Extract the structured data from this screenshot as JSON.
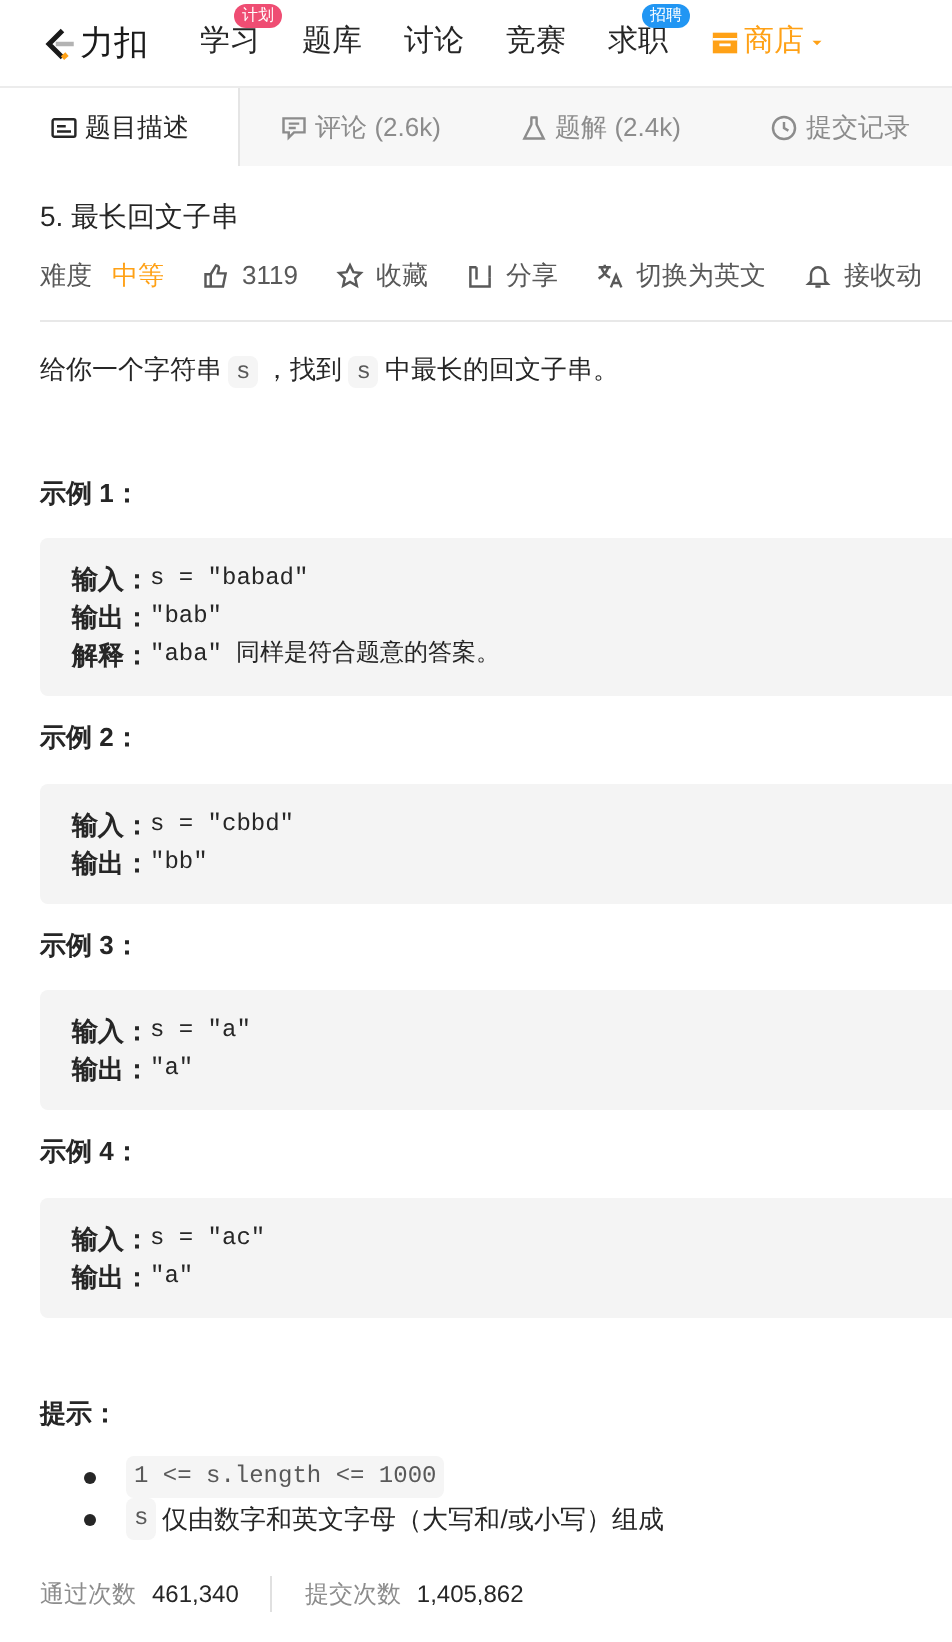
{
  "nav": {
    "logo_text": "力扣",
    "items": [
      {
        "label": "学习",
        "badge": {
          "text": "计划",
          "color": "#ef4d73"
        }
      },
      {
        "label": "题库"
      },
      {
        "label": "讨论"
      },
      {
        "label": "竞赛"
      },
      {
        "label": "求职",
        "badge": {
          "text": "招聘",
          "color": "#2196f3"
        }
      },
      {
        "label": "商店",
        "kind": "shop"
      }
    ]
  },
  "tabs": [
    {
      "label": "题目描述",
      "selected": true
    },
    {
      "label": "评论 (2.6k)",
      "selected": false
    },
    {
      "label": "题解 (2.4k)",
      "selected": false
    },
    {
      "label": "提交记录",
      "selected": false
    }
  ],
  "problem": {
    "title": "5. 最长回文子串",
    "difficulty_label": "难度",
    "difficulty": "中等",
    "actions": [
      {
        "label": "3119"
      },
      {
        "label": "收藏"
      },
      {
        "label": "分享"
      },
      {
        "label": "切换为英文"
      },
      {
        "label": "接收动"
      }
    ]
  },
  "description": [
    {
      "kind": "text",
      "text": "给你一个字符串"
    },
    {
      "kind": "code",
      "text": "s"
    },
    {
      "kind": "text",
      "text": "，找到"
    },
    {
      "kind": "code",
      "text": "s"
    },
    {
      "kind": "text",
      "text": "中最长的回文子串。"
    }
  ],
  "examples": [
    {
      "title": "示例 1：",
      "lines": [
        {
          "label": "输入：",
          "value": "s = \"babad\""
        },
        {
          "label": "输出：",
          "value": "\"bab\""
        },
        {
          "label": "解释：",
          "value": "\"aba\" 同样是符合题意的答案。"
        }
      ]
    },
    {
      "title": "示例 2：",
      "lines": [
        {
          "label": "输入：",
          "value": "s = \"cbbd\""
        },
        {
          "label": "输出：",
          "value": "\"bb\""
        }
      ]
    },
    {
      "title": "示例 3：",
      "lines": [
        {
          "label": "输入：",
          "value": "s = \"a\""
        },
        {
          "label": "输出：",
          "value": "\"a\""
        }
      ]
    },
    {
      "title": "示例 4：",
      "lines": [
        {
          "label": "输入：",
          "value": "s = \"ac\""
        },
        {
          "label": "输出：",
          "value": "\"a\""
        }
      ]
    }
  ],
  "tips": {
    "title": "提示：",
    "items": [
      [
        {
          "kind": "code",
          "text": "1 <= s.length <= 1000"
        }
      ],
      [
        {
          "kind": "code",
          "text": "s"
        },
        {
          "kind": "text",
          "text": "仅由数字和英文字母（大写和/或小写）组成"
        }
      ]
    ]
  },
  "stats": [
    {
      "label": "通过次数",
      "value": "461,340"
    },
    {
      "label": "提交次数",
      "value": "1,405,862"
    }
  ]
}
